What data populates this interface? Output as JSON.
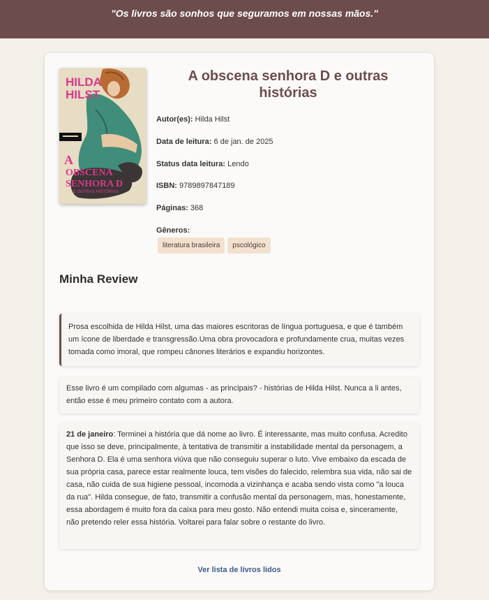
{
  "header": {
    "quote": "\"Os livros são sonhos que seguramos em nossas mãos.\""
  },
  "book": {
    "cover": {
      "author_text": "HILDA HILST",
      "title_text": "A OBSCENA SENHORA D",
      "subtitle_text": "E OUTRAS HISTÓRIAS"
    },
    "title": "A obscena senhora D e outras histórias",
    "fields": {
      "author_label": "Autor(es):",
      "author_value": "Hilda Hilst",
      "date_label": "Data de leitura:",
      "date_value": "6 de jan. de 2025",
      "status_label": "Status data leitura:",
      "status_value": "Lendo",
      "isbn_label": "ISBN:",
      "isbn_value": "9789897847189",
      "pages_label": "Páginas:",
      "pages_value": "368",
      "genres_label": "Gêneros:"
    },
    "genres": [
      "literatura brasileira",
      "pscológico"
    ]
  },
  "review": {
    "heading": "Minha Review",
    "quote_text": "Prosa escolhida de Hilda Hilst, uma das maiores escritoras de língua portuguesa, e que é também um ícone de liberdade e transgressão.Uma obra provocadora e profundamente crua, muitas vezes tomada como imoral, que rompeu cânones literários e expandiu horizontes.",
    "paragraph1": "Esse livro é um compilado com algumas - as principais? - histórias de Hilda Hilst. Nunca a li antes, então esse é meu primeiro contato com a autora.",
    "entry_date": "21 de janeiro",
    "entry_text": ": Terminei a história que dá nome ao livro. É interessante, mas muito confusa. Acredito que isso se deve, principalmente, à tentativa de transmitir a instabilidade mental da personagem, a Senhora D. Ela é uma senhora viúva que não conseguiu superar o luto. Vive embaixo da escada de sua própria casa, parece estar realmente louca, tem visões do falecido, relembra sua vida, não sai de casa, não cuida de sua higiene pessoal, incomoda a vizinhança e acaba sendo vista como \"a louca da rua\". Hilda consegue, de fato, transmitir a confusão mental da personagem, mas, honestamente, essa abordagem é muito fora da caixa para meu gosto. Não entendi muita coisa e, sinceramente, não pretendo reler essa história. Voltarei para falar sobre o restante do livro."
  },
  "footer": {
    "link_label": "Ver lista de livros lidos"
  },
  "colors": {
    "header_bg": "#6d4c4d",
    "page_bg": "#f4f0ea",
    "card_bg": "#fbfaf8",
    "title": "#6d4c4d",
    "tag_bg": "#f2e1cf",
    "link": "#3d5a8a"
  }
}
